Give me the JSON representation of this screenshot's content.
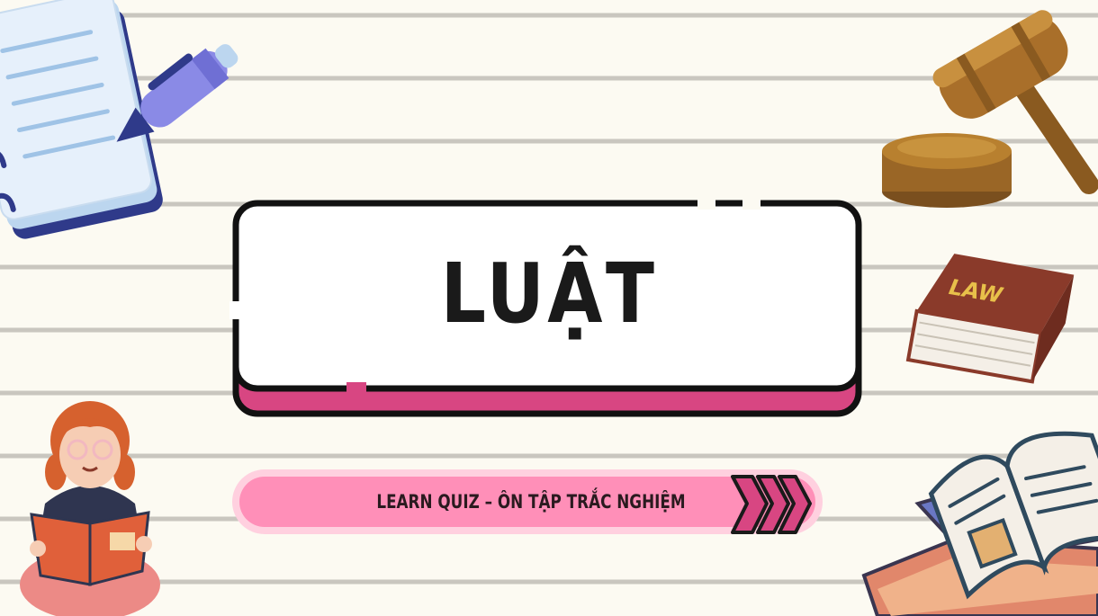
{
  "title": "LUẬT",
  "subtitle_pill": "LEARN QUIZ – ÔN TẬP TRẮC NGHIỆM",
  "book_label": "LAW",
  "icons": [
    "notebook-icon",
    "pen-icon",
    "gavel-icon",
    "law-book-icon",
    "open-books-icon",
    "reading-girl-icon",
    "chevron-arrows-icon"
  ],
  "colors": {
    "background": "#fcfaf2",
    "ruled_lines": "#c9c6bf",
    "accent_pink": "#d84682",
    "pill_pink": "#ff8fb8",
    "pill_border": "#ffd0df"
  }
}
